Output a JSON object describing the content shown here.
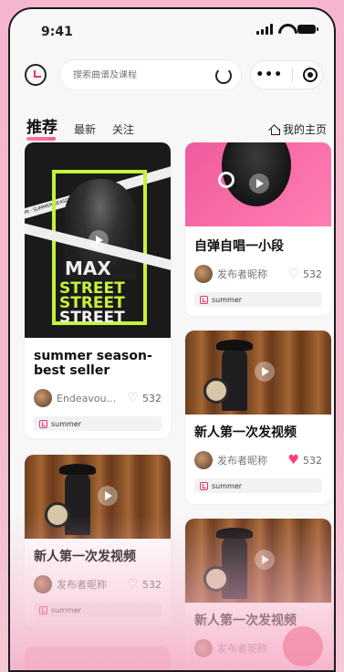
{
  "status": {
    "time": "9:41"
  },
  "search": {
    "placeholder": "搜索曲谱及课程"
  },
  "tabs": [
    {
      "label": "推荐"
    },
    {
      "label": "最新"
    },
    {
      "label": "关注"
    }
  ],
  "home_link": "我的主页",
  "cards": [
    {
      "title": "summer season-best seller",
      "author": "Endeavou...",
      "likes": "532",
      "tag": "summer",
      "poster_words": [
        "MAX",
        "STREET",
        "STREET",
        "STREET"
      ],
      "poster_band": "FASHION · SUMMER SEASON · BEST SELLER"
    },
    {
      "title": "自弹自唱一小段",
      "author": "发布者昵称",
      "likes": "532",
      "tag": "summer"
    },
    {
      "title": "新人第一次发视频",
      "author": "发布者昵称",
      "likes": "532",
      "tag": "summer",
      "liked": true
    },
    {
      "title": "新人第一次发视频",
      "author": "发布者昵称",
      "likes": "532",
      "tag": "summer"
    },
    {
      "title": "新人第一次发视频",
      "author": "发布者昵称"
    }
  ],
  "colors": {
    "accent": "#e8336b",
    "lime": "#c6f23b",
    "liked_heart": "#ff3d7f",
    "bg_pink": "#f6b6cf"
  }
}
